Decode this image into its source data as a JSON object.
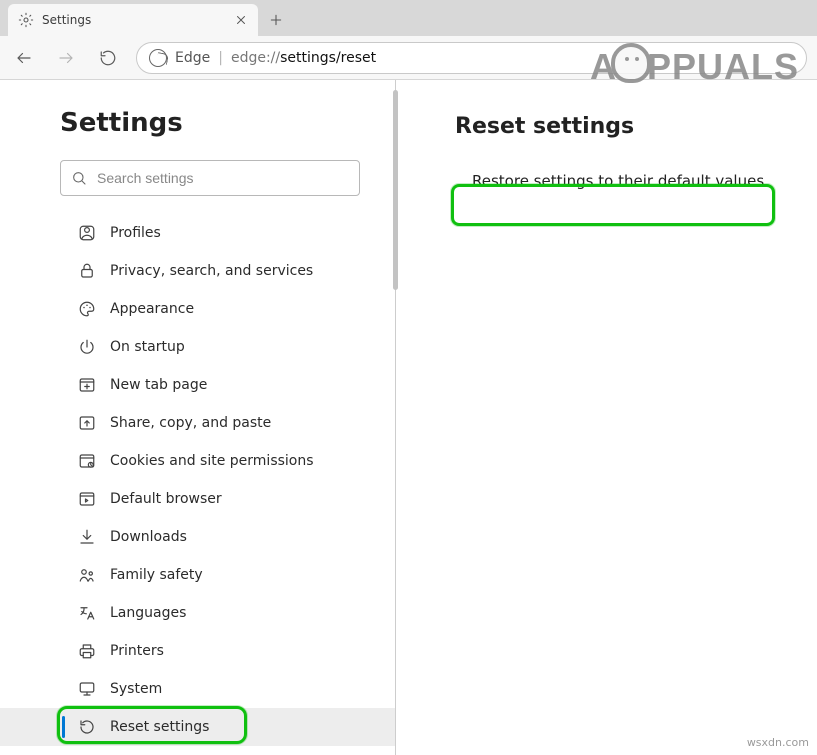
{
  "tab": {
    "title": "Settings"
  },
  "address": {
    "product": "Edge",
    "url_prefix": "edge://",
    "url_path": "settings/reset"
  },
  "page": {
    "title": "Settings"
  },
  "search": {
    "placeholder": "Search settings"
  },
  "sidebar": {
    "items": [
      {
        "label": "Profiles"
      },
      {
        "label": "Privacy, search, and services"
      },
      {
        "label": "Appearance"
      },
      {
        "label": "On startup"
      },
      {
        "label": "New tab page"
      },
      {
        "label": "Share, copy, and paste"
      },
      {
        "label": "Cookies and site permissions"
      },
      {
        "label": "Default browser"
      },
      {
        "label": "Downloads"
      },
      {
        "label": "Family safety"
      },
      {
        "label": "Languages"
      },
      {
        "label": "Printers"
      },
      {
        "label": "System"
      },
      {
        "label": "Reset settings"
      }
    ]
  },
  "main": {
    "heading": "Reset settings",
    "option": "Restore settings to their default values"
  },
  "watermark": "PPUALS",
  "attribution": "wsxdn.com"
}
